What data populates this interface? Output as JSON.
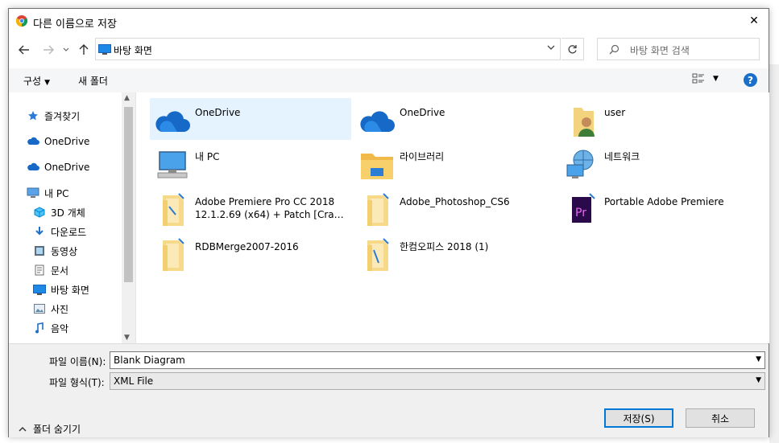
{
  "dialog": {
    "title": "다른 이름으로 저장",
    "close_symbol": "✕"
  },
  "address": {
    "location": "바탕 화면",
    "search_placeholder": "바탕 화면 검색"
  },
  "toolbar": {
    "organize_label": "구성",
    "new_folder_label": "새 폴더",
    "help_symbol": "?"
  },
  "navpane": {
    "items": [
      {
        "label": "즐겨찾기",
        "icon": "star-icon"
      },
      {
        "label": "OneDrive",
        "icon": "cloud-icon"
      },
      {
        "label": "OneDrive",
        "icon": "cloud-icon"
      },
      {
        "label": "내 PC",
        "icon": "pc-icon"
      },
      {
        "label": "3D 개체",
        "icon": "cube-icon"
      },
      {
        "label": "다운로드",
        "icon": "download-icon"
      },
      {
        "label": "동영상",
        "icon": "video-icon"
      },
      {
        "label": "문서",
        "icon": "document-icon"
      },
      {
        "label": "바탕 화면",
        "icon": "desktop-icon"
      },
      {
        "label": "사진",
        "icon": "picture-icon"
      },
      {
        "label": "음악",
        "icon": "music-icon"
      }
    ]
  },
  "files": [
    {
      "name": "OneDrive",
      "icon": "onedrive-icon"
    },
    {
      "name": "OneDrive",
      "icon": "onedrive-icon"
    },
    {
      "name": "user",
      "icon": "user-folder-icon"
    },
    {
      "name": "내 PC",
      "icon": "pc-icon"
    },
    {
      "name": "라이브러리",
      "icon": "library-folder-icon"
    },
    {
      "name": "네트워크",
      "icon": "network-icon"
    },
    {
      "name": "Adobe Premiere Pro CC 2018",
      "name2": "12.1.2.69 (x64) + Patch [Cracks...",
      "icon": "folder-shortcut-icon"
    },
    {
      "name": "Adobe_Photoshop_CS6",
      "icon": "folder-shortcut-icon"
    },
    {
      "name": "Portable Adobe Premiere",
      "icon": "premiere-shortcut-icon"
    },
    {
      "name": "RDBMerge2007-2016",
      "icon": "folder-shortcut-icon"
    },
    {
      "name": "한컴오피스 2018 (1)",
      "icon": "folder-shortcut-icon"
    }
  ],
  "form": {
    "filename_label": "파일 이름(N):",
    "filename_value": "Blank Diagram",
    "filetype_label": "파일 형식(T):",
    "filetype_value": "XML File",
    "hide_folders_label": "폴더 숨기기",
    "save_label": "저장(S)",
    "cancel_label": "취소"
  },
  "colors": {
    "accent": "#0078d7",
    "selection": "#e5f3ff",
    "help": "#1a70c9"
  }
}
